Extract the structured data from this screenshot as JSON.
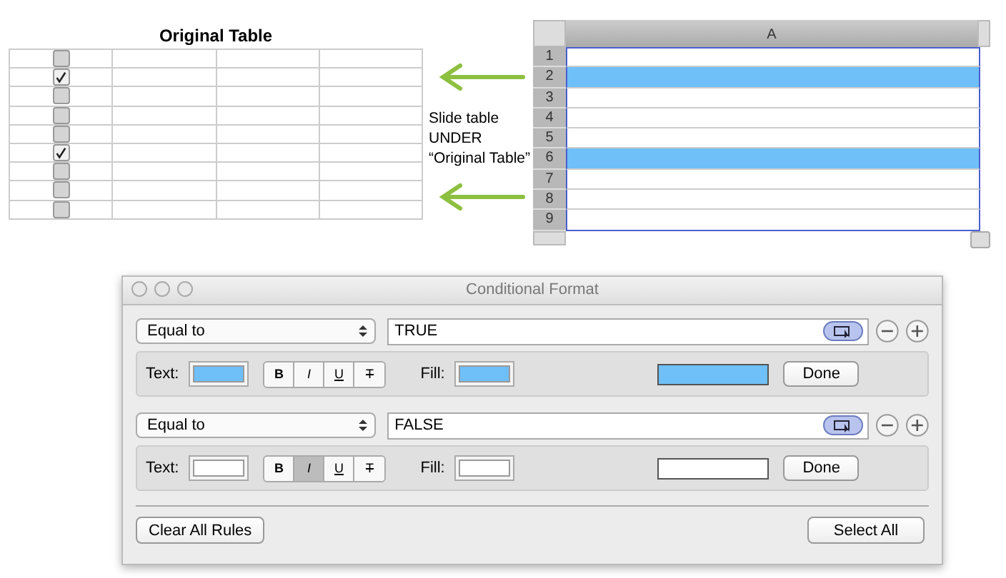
{
  "original_table": {
    "title": "Original Table",
    "rows": [
      {
        "checked": false
      },
      {
        "checked": true
      },
      {
        "checked": false
      },
      {
        "checked": false
      },
      {
        "checked": false
      },
      {
        "checked": true
      },
      {
        "checked": false
      },
      {
        "checked": false
      },
      {
        "checked": false
      }
    ]
  },
  "note": "Slide table UNDER “Original Table”",
  "sheet": {
    "column": "A",
    "rows": [
      {
        "label": "1",
        "color": "#ffffff"
      },
      {
        "label": "2",
        "color": "#6fbff8"
      },
      {
        "label": "3",
        "color": "#ffffff"
      },
      {
        "label": "4",
        "color": "#ffffff"
      },
      {
        "label": "5",
        "color": "#ffffff"
      },
      {
        "label": "6",
        "color": "#6fbff8"
      },
      {
        "label": "7",
        "color": "#ffffff"
      },
      {
        "label": "8",
        "color": "#ffffff"
      },
      {
        "label": "9",
        "color": "#ffffff"
      }
    ]
  },
  "dialog": {
    "title": "Conditional Format",
    "rules": [
      {
        "condition": "Equal to",
        "value": "TRUE",
        "text_label": "Text:",
        "text_well": {
          "color": "#6fbff8"
        },
        "styles": [
          {
            "kind": "bold",
            "label": "B",
            "selected": false
          },
          {
            "kind": "italic",
            "label": "I",
            "selected": false
          },
          {
            "kind": "underline",
            "label": "U",
            "selected": false
          },
          {
            "kind": "strike",
            "label": "T",
            "selected": false
          }
        ],
        "fill_label": "Fill:",
        "fill_well": {
          "color": "#6fbff8"
        },
        "done": "Done"
      },
      {
        "condition": "Equal to",
        "value": "FALSE",
        "text_label": "Text:",
        "text_well": {
          "color": "#ffffff"
        },
        "styles": [
          {
            "kind": "bold",
            "label": "B",
            "selected": false
          },
          {
            "kind": "italic",
            "label": "I",
            "selected": true
          },
          {
            "kind": "underline",
            "label": "U",
            "selected": false
          },
          {
            "kind": "strike",
            "label": "T",
            "selected": false
          }
        ],
        "fill_label": "Fill:",
        "fill_well": {
          "color": "#ffffff"
        },
        "done": "Done"
      }
    ],
    "buttons": [
      "Clear All Rules",
      "Select All"
    ]
  }
}
